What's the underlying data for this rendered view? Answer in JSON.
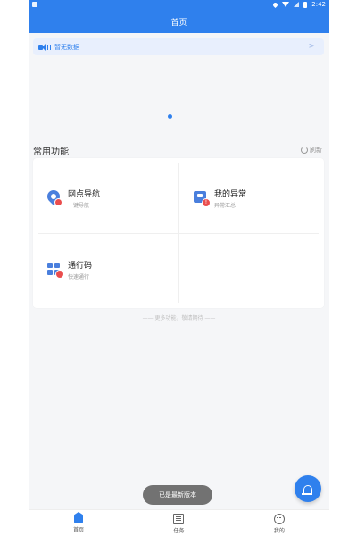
{
  "colors": {
    "primary": "#2f80ed",
    "badge": "#ea4d4d"
  },
  "status_bar": {
    "time": "2:42"
  },
  "header": {
    "title": "首页"
  },
  "notice": {
    "text": "暂无数据",
    "arrow": ">"
  },
  "section": {
    "title": "常用功能",
    "refresh_label": "刷新"
  },
  "functions": [
    {
      "title": "网点导航",
      "subtitle": "一键导航",
      "icon": "location-pin-icon"
    },
    {
      "title": "我的异常",
      "subtitle": "异常汇总",
      "icon": "exception-card-icon",
      "badge": "!"
    },
    {
      "title": "通行码",
      "subtitle": "快速通行",
      "icon": "grid-pass-icon"
    }
  ],
  "more_hint": "—— 更多功能，敬请期待 ——",
  "toast": "已是最新版本",
  "tabs": [
    {
      "label": "首页",
      "icon": "home-icon",
      "active": true
    },
    {
      "label": "任务",
      "icon": "task-icon",
      "active": false
    },
    {
      "label": "我的",
      "icon": "profile-icon",
      "active": false
    }
  ]
}
